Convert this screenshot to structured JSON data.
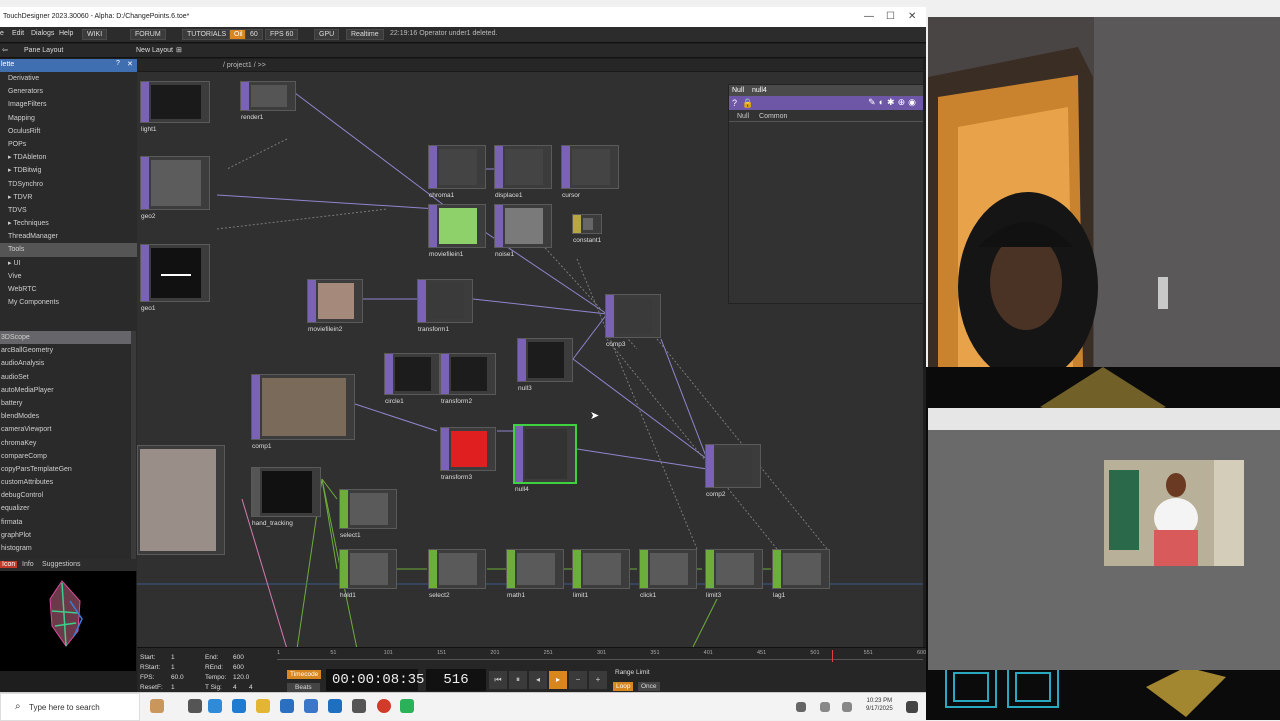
{
  "window": {
    "title": "TouchDesigner 2023.30060 - Alpha: D:/ChangePoints.6.toe*",
    "controls": [
      "—",
      "☐",
      "✕"
    ]
  },
  "menubar": {
    "items": [
      "e",
      "Edit",
      "Dialogs",
      "Help"
    ],
    "wiki": "WIKI",
    "forum": "FORUM",
    "tutorials": "TUTORIALS",
    "oil": "Oil",
    "sixty": "60",
    "fps": "FPS  60",
    "gpu": "GPU",
    "realtime": "Realtime",
    "status": "22:19:16 Operator under1 deleted."
  },
  "panebar": {
    "pane_layout": "Pane Layout",
    "new_layout": "New Layout"
  },
  "palette": {
    "header": "lette",
    "items": [
      "Derivative",
      "Generators",
      "ImageFilters",
      "Mapping",
      "OculusRift",
      "POPs",
      "▸ TDAbleton",
      "▸ TDBitwig",
      "TDSynchro",
      "▸ TDVR",
      "TDVS",
      "▸ Techniques",
      "ThreadManager",
      "Tools",
      "▸ UI",
      "Vive",
      "WebRTC",
      "My Components"
    ],
    "selected_index": 13,
    "sub_items": [
      "3DScope",
      "arcBallGeometry",
      "audioAnalysis",
      "audioSet",
      "autoMediaPlayer",
      "battery",
      "blendModes",
      "cameraViewport",
      "chromaKey",
      "compareComp",
      "copyParsTemplateGen",
      "customAttributes",
      "debugControl",
      "equalizer",
      "firmata",
      "graphPlot",
      "histogram"
    ],
    "sub_selected_index": 0
  },
  "info_tabs": [
    "Icon",
    "Info",
    "Suggestions"
  ],
  "network": {
    "path": "/ project1 / >>",
    "nodes": {
      "light1": "light1",
      "render1": "render1",
      "geo2": "geo2",
      "geo1": "geo1",
      "chroma1": "chroma1",
      "displace1": "displace1",
      "cursor": "cursor",
      "moviefilein1": "moviefilein1",
      "noise1": "noise1",
      "constant1": "constant1",
      "moviefilein2": "moviefilein2",
      "transform1": "transform1",
      "comp3": "comp3",
      "circle1": "circle1",
      "transform2": "transform2",
      "null3": "null3",
      "comp1": "comp1",
      "transform3": "transform3",
      "null4": "null4",
      "comp2": "comp2",
      "hand_tracking": "hand_tracking",
      "select1": "select1",
      "hold1": "hold1",
      "select2": "select2",
      "math1": "math1",
      "limit1": "limit1",
      "click1": "click1",
      "limit3": "limit3",
      "lag1": "lag1"
    }
  },
  "param": {
    "type": "Null",
    "name": "null4",
    "tabs": [
      "Null",
      "Common"
    ]
  },
  "timeline": {
    "start_label": "Start:",
    "start": "1",
    "rstart_label": "RStart:",
    "rstart": "1",
    "fps_label": "FPS:",
    "fps": "60.0",
    "resetf_label": "ResetF:",
    "resetf": "1",
    "end_label": "End:",
    "end": "600",
    "rend_label": "REnd:",
    "rend": "600",
    "tempo_label": "Tempo:",
    "tempo": "120.0",
    "tsig_label": "T Sig:",
    "tsig_a": "4",
    "tsig_b": "4",
    "ticks": [
      "1",
      "51",
      "101",
      "151",
      "201",
      "251",
      "301",
      "351",
      "401",
      "451",
      "501",
      "551",
      "600"
    ],
    "timecode_label": "Timecode",
    "beats_label": "Beats",
    "timecode": "00:00:08:35",
    "frame": "516",
    "range_limit": "Range Limit",
    "loop": "Loop",
    "once": "Once"
  },
  "taskbar": {
    "search_placeholder": "Type here to search",
    "time": "10:23 PM",
    "date": "9/17/2025"
  },
  "colors": {
    "top_operator": "#7a63b5",
    "chop_operator": "#6dad3c",
    "palette_header": "#3f6fb0",
    "wire": "#9b8fe0"
  }
}
